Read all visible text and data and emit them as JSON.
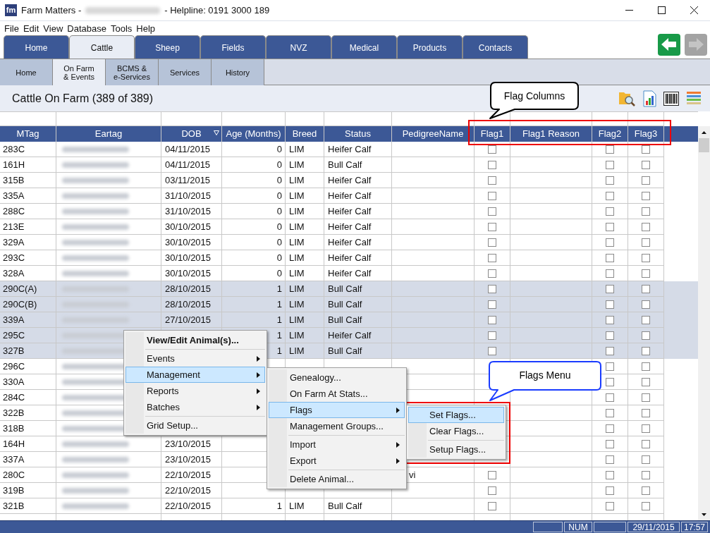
{
  "window": {
    "logo": "fm",
    "title_start": "Farm Matters -",
    "title_end": "- Helpline: 0191 3000 189"
  },
  "menu_bar": [
    "File",
    "Edit",
    "View",
    "Database",
    "Tools",
    "Help"
  ],
  "tabs": [
    {
      "label": "Home",
      "selected": false
    },
    {
      "label": "Cattle",
      "selected": true
    },
    {
      "label": "Sheep",
      "selected": false
    },
    {
      "label": "Fields",
      "selected": false
    },
    {
      "label": "NVZ",
      "selected": false
    },
    {
      "label": "Medical",
      "selected": false
    },
    {
      "label": "Products",
      "selected": false
    },
    {
      "label": "Contacts",
      "selected": false
    }
  ],
  "nav": {
    "back_disabled": false,
    "forward_disabled": true
  },
  "sub_tabs": [
    {
      "label": "Home",
      "selected": false
    },
    {
      "label": "On Farm\n& Events",
      "selected": true
    },
    {
      "label": "BCMS &\ne-Services",
      "selected": false
    },
    {
      "label": "Services",
      "selected": false
    },
    {
      "label": "History",
      "selected": false
    }
  ],
  "heading": "Cattle On Farm (389 of 389)",
  "table": {
    "columns": [
      "MTag",
      "Eartag",
      "DOB",
      "Age (Months)",
      "Breed",
      "Status",
      "PedigreeName",
      "Flag1",
      "Flag1 Reason",
      "Flag2",
      "Flag3"
    ],
    "rows": [
      {
        "mtag": "283C",
        "dob": "04/11/2015",
        "age": "0",
        "breed": "LIM",
        "status": "Heifer Calf",
        "flag1": false,
        "flag2": false,
        "flag3": false,
        "selected": false
      },
      {
        "mtag": "161H",
        "dob": "04/11/2015",
        "age": "0",
        "breed": "LIM",
        "status": "Bull Calf",
        "flag1": false,
        "flag2": false,
        "flag3": false,
        "selected": false
      },
      {
        "mtag": "315B",
        "dob": "03/11/2015",
        "age": "0",
        "breed": "LIM",
        "status": "Heifer Calf",
        "flag1": false,
        "flag2": false,
        "flag3": false,
        "selected": false
      },
      {
        "mtag": "335A",
        "dob": "31/10/2015",
        "age": "0",
        "breed": "LIM",
        "status": "Heifer Calf",
        "flag1": false,
        "flag2": false,
        "flag3": false,
        "selected": false
      },
      {
        "mtag": "288C",
        "dob": "31/10/2015",
        "age": "0",
        "breed": "LIM",
        "status": "Heifer Calf",
        "flag1": false,
        "flag2": false,
        "flag3": false,
        "selected": false
      },
      {
        "mtag": "213E",
        "dob": "30/10/2015",
        "age": "0",
        "breed": "LIM",
        "status": "Heifer Calf",
        "flag1": false,
        "flag2": false,
        "flag3": false,
        "selected": false
      },
      {
        "mtag": "329A",
        "dob": "30/10/2015",
        "age": "0",
        "breed": "LIM",
        "status": "Heifer Calf",
        "flag1": false,
        "flag2": false,
        "flag3": false,
        "selected": false
      },
      {
        "mtag": "293C",
        "dob": "30/10/2015",
        "age": "0",
        "breed": "LIM",
        "status": "Heifer Calf",
        "flag1": false,
        "flag2": false,
        "flag3": false,
        "selected": false
      },
      {
        "mtag": "328A",
        "dob": "30/10/2015",
        "age": "0",
        "breed": "LIM",
        "status": "Heifer Calf",
        "flag1": false,
        "flag2": false,
        "flag3": false,
        "selected": false
      },
      {
        "mtag": "290C(A)",
        "dob": "28/10/2015",
        "age": "1",
        "breed": "LIM",
        "status": "Bull Calf",
        "flag1": false,
        "flag2": false,
        "flag3": false,
        "selected": true
      },
      {
        "mtag": "290C(B)",
        "dob": "28/10/2015",
        "age": "1",
        "breed": "LIM",
        "status": "Bull Calf",
        "flag1": false,
        "flag2": false,
        "flag3": false,
        "selected": true
      },
      {
        "mtag": "339A",
        "dob": "27/10/2015",
        "age": "1",
        "breed": "LIM",
        "status": "Bull Calf",
        "flag1": false,
        "flag2": false,
        "flag3": false,
        "selected": true
      },
      {
        "mtag": "295C",
        "age": "1",
        "breed": "LIM",
        "status": "Heifer Calf",
        "flag1": false,
        "flag2": false,
        "flag3": false,
        "selected": true
      },
      {
        "mtag": "327B",
        "age": "1",
        "breed": "LIM",
        "status": "Bull Calf",
        "flag1": false,
        "flag2": false,
        "flag3": false,
        "selected": true
      },
      {
        "mtag": "296C",
        "flag2": false,
        "flag3": false,
        "selected": false
      },
      {
        "mtag": "330A",
        "flag2": false,
        "flag3": false,
        "selected": false
      },
      {
        "mtag": "284C",
        "flag2": false,
        "flag3": false,
        "selected": false
      },
      {
        "mtag": "322B",
        "flag2": false,
        "flag3": false,
        "selected": false
      },
      {
        "mtag": "318B",
        "flag2": false,
        "flag3": false,
        "selected": false
      },
      {
        "mtag": "164H",
        "dob": "23/10/2015",
        "flag2": false,
        "flag3": false,
        "selected": false
      },
      {
        "mtag": "337A",
        "dob": "23/10/2015",
        "flag2": false,
        "flag3": false,
        "selected": false
      },
      {
        "mtag": "280C",
        "dob": "22/10/2015",
        "pedigree": "vi",
        "flag1": false,
        "flag2": false,
        "flag3": false,
        "selected": false
      },
      {
        "mtag": "319B",
        "dob": "22/10/2015",
        "flag1": false,
        "flag2": false,
        "flag3": false,
        "selected": false
      },
      {
        "mtag": "321B",
        "dob": "22/10/2015",
        "age": "1",
        "breed": "LIM",
        "status": "Bull Calf",
        "flag1": false,
        "flag2": false,
        "flag3": false,
        "selected": false
      }
    ]
  },
  "context_menu": {
    "items": [
      {
        "kind": "item",
        "label": "View/Edit Animal(s)...",
        "bold": true,
        "arrow": false,
        "selected": false
      },
      {
        "kind": "separator"
      },
      {
        "kind": "item",
        "label": "Events",
        "bold": false,
        "arrow": true,
        "selected": false
      },
      {
        "kind": "item",
        "label": "Management",
        "bold": false,
        "arrow": true,
        "selected": true
      },
      {
        "kind": "item",
        "label": "Reports",
        "bold": false,
        "arrow": true,
        "selected": false
      },
      {
        "kind": "item",
        "label": "Batches",
        "bold": false,
        "arrow": true,
        "selected": false
      },
      {
        "kind": "separator"
      },
      {
        "kind": "item",
        "label": "Grid Setup...",
        "bold": false,
        "arrow": false,
        "selected": false
      }
    ]
  },
  "management_menu": {
    "items": [
      {
        "kind": "item",
        "label": "Genealogy...",
        "bold": false,
        "arrow": false,
        "selected": false
      },
      {
        "kind": "item",
        "label": "On Farm At Stats...",
        "bold": false,
        "arrow": false,
        "selected": false
      },
      {
        "kind": "item",
        "label": "Flags",
        "bold": false,
        "arrow": true,
        "selected": true
      },
      {
        "kind": "item",
        "label": "Management Groups...",
        "bold": false,
        "arrow": false,
        "selected": false
      },
      {
        "kind": "separator"
      },
      {
        "kind": "item",
        "label": "Import",
        "bold": false,
        "arrow": true,
        "selected": false
      },
      {
        "kind": "item",
        "label": "Export",
        "bold": false,
        "arrow": true,
        "selected": false
      },
      {
        "kind": "separator"
      },
      {
        "kind": "item",
        "label": "Delete Animal...",
        "bold": false,
        "arrow": false,
        "selected": false
      }
    ]
  },
  "flags_menu": {
    "items": [
      {
        "kind": "item",
        "label": "Set Flags...",
        "bold": false,
        "arrow": false,
        "selected": true
      },
      {
        "kind": "item",
        "label": "Clear Flags...",
        "bold": false,
        "arrow": false,
        "selected": false
      },
      {
        "kind": "separator"
      },
      {
        "kind": "item",
        "label": "Setup Flags...",
        "bold": false,
        "arrow": false,
        "selected": false
      }
    ]
  },
  "annotations": [
    {
      "kind": "callout",
      "text": "Flag Columns",
      "color": "#000000"
    },
    {
      "kind": "callout",
      "text": "Flags Menu",
      "color": "#1a3cff"
    }
  ],
  "status_bar": {
    "panels": [
      "NUM",
      "29/11/2015",
      "17:57"
    ]
  }
}
